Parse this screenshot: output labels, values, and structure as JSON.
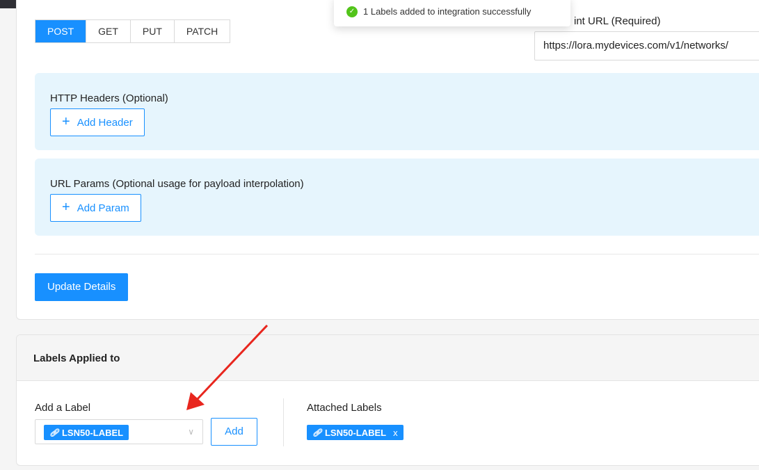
{
  "toast": {
    "message": "1 Labels added to integration successfully"
  },
  "request": {
    "methods": [
      "POST",
      "GET",
      "PUT",
      "PATCH"
    ],
    "active_method": "POST",
    "endpoint_label": "int URL (Required)",
    "endpoint_value": "https://lora.mydevices.com/v1/networks/"
  },
  "headers_panel": {
    "title": "HTTP Headers (Optional)",
    "button_label": "Add Header"
  },
  "params_panel": {
    "title": "URL Params (Optional usage for payload interpolation)",
    "button_label": "Add Param"
  },
  "update_button": "Update Details",
  "labels_section": {
    "title": "Labels Applied to",
    "add_label_title": "Add a Label",
    "selected_label": "LSN50-LABEL",
    "add_button": "Add",
    "attached_title": "Attached Labels",
    "attached_labels": [
      "LSN50-LABEL"
    ],
    "remove_glyph": "x"
  },
  "colors": {
    "accent": "#1890ff",
    "panel_bg": "#e6f5fd",
    "success": "#52c41a",
    "annotation": "#e8261e"
  }
}
